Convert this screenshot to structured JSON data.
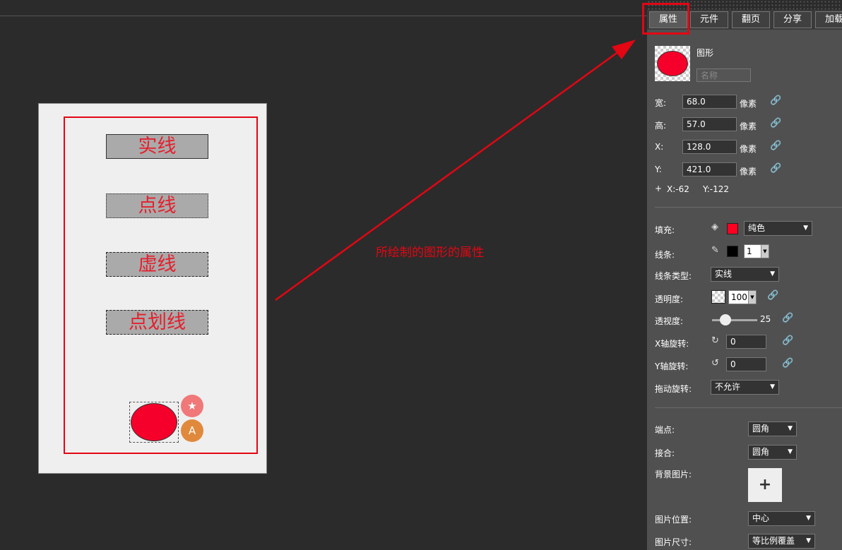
{
  "canvas": {
    "samples": [
      "实线",
      "点线",
      "虚线",
      "点划线"
    ]
  },
  "annotation": {
    "text": "所绘制的图形的属性",
    "color": "#e30613"
  },
  "tabs": [
    "属性",
    "元件",
    "翻页",
    "分享",
    "加载"
  ],
  "shape": {
    "type_label": "图形",
    "name_placeholder": "名称",
    "fill_color": "#f5002a"
  },
  "geometry": {
    "width_label": "宽:",
    "width_value": "68.0",
    "height_label": "高:",
    "height_value": "57.0",
    "x_label": "X:",
    "x_value": "128.0",
    "y_label": "Y:",
    "y_value": "421.0",
    "unit": "像素",
    "offset_plus": "+",
    "offset_x": "X:-62",
    "offset_y": "Y:-122"
  },
  "style": {
    "fill_label": "填充:",
    "fill_mode": "纯色",
    "fill_color": "#ff0020",
    "stroke_label": "线条:",
    "stroke_width": "1",
    "stroke_color": "#000000",
    "stroke_type_label": "线条类型:",
    "stroke_type": "实线",
    "opacity_label": "透明度:",
    "opacity_value": "100",
    "perspective_label": "透视度:",
    "perspective_value": "25",
    "x_rotate_label": "X轴旋转:",
    "x_rotate_value": "0",
    "y_rotate_label": "Y轴旋转:",
    "y_rotate_value": "0",
    "drag_rotate_label": "拖动旋转:",
    "drag_rotate_value": "不允许"
  },
  "lines": {
    "cap_label": "端点:",
    "cap_value": "圆角",
    "join_label": "接合:",
    "join_value": "圆角",
    "bg_image_label": "背景图片:",
    "bg_add": "+",
    "image_position_label": "图片位置:",
    "image_position_value": "中心",
    "image_size_label": "图片尺寸:",
    "image_size_value": "等比例覆盖"
  }
}
